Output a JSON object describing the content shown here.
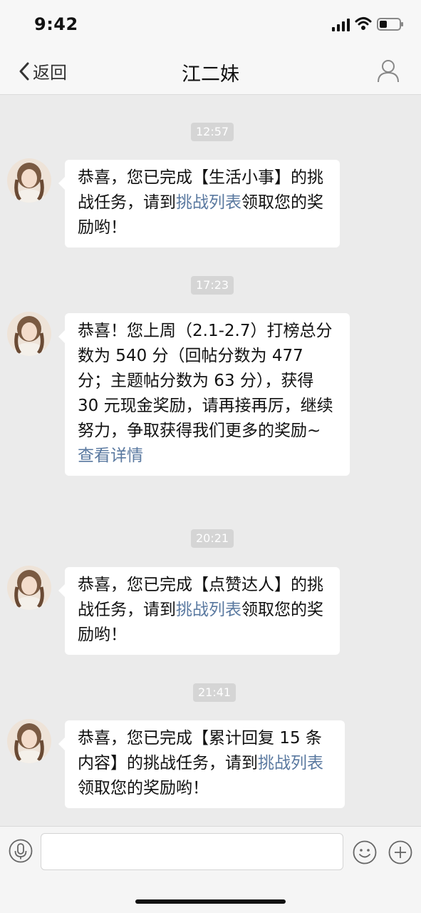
{
  "status_bar": {
    "time": "9:42"
  },
  "nav": {
    "back_label": "返回",
    "title": "江二妹"
  },
  "messages": [
    {
      "timestamp": "12:57",
      "pre": "恭喜，您已完成【生活小事】的挑战任务，请到",
      "link": "挑战列表",
      "post": "领取您的奖励哟！"
    },
    {
      "timestamp": "17:23",
      "text": "恭喜！您上周（2.1-2.7）打榜总分数为 540 分（回帖分数为 477 分；主题帖分数为 63 分），获得 30 元现金奖励，请再接再厉，继续努力，争取获得我们更多的奖励~",
      "link": "查看详情"
    },
    {
      "timestamp": "20:21",
      "pre": "恭喜，您已完成【点赞达人】的挑战任务，请到",
      "link": "挑战列表",
      "post": "领取您的奖励哟！"
    },
    {
      "timestamp": "21:41",
      "pre": "恭喜，您已完成【累计回复 15 条内容】的挑战任务，请到",
      "link": "挑战列表",
      "post": "领取您的奖励哟！"
    }
  ],
  "input_bar": {
    "value": "",
    "placeholder": ""
  },
  "icons": {
    "back": "chevron-left-icon",
    "profile": "person-icon",
    "voice": "microphone-icon",
    "emoji": "smiley-icon",
    "more": "plus-circle-icon"
  },
  "colors": {
    "link": "#5a79a0",
    "background": "#ebebeb",
    "timestamp_bg": "#d5d5d5"
  }
}
